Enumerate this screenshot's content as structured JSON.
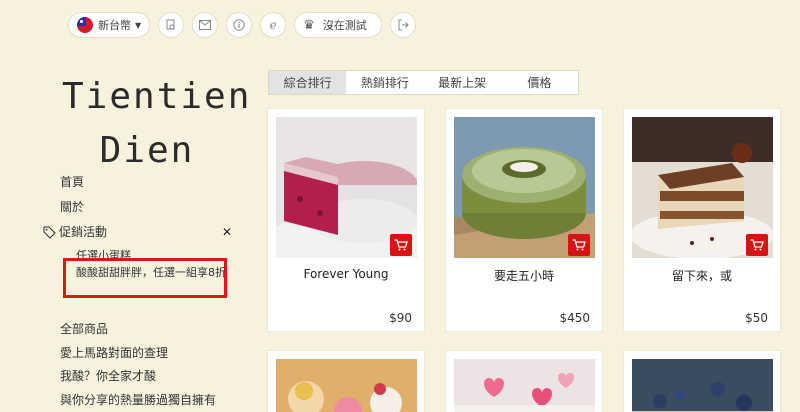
{
  "header": {
    "currency_label": "新台幣",
    "account_label": "沒在測試"
  },
  "logo": {
    "line1": "Tientien",
    "line2": "Dien"
  },
  "nav": {
    "items": [
      "首頁",
      "關於"
    ],
    "promo_label": "促銷活動",
    "promo_sub": [
      "任選小蛋糕",
      "酸酸甜甜胖胖，任選一組享8折"
    ],
    "more_items": [
      "全部商品",
      "愛上馬路對面的查理",
      "我酸？你全家才酸",
      "與你分享的熱量勝過獨自擁有"
    ]
  },
  "tabs": [
    "綜合排行",
    "熱銷排行",
    "最新上架",
    "價格"
  ],
  "products": [
    {
      "name": "Forever Young",
      "price": "$90"
    },
    {
      "name": "要走五小時",
      "price": "$450"
    },
    {
      "name": "留下來，或",
      "price": "$50"
    }
  ],
  "colors": {
    "background": "#f6f2dd",
    "accent": "#d81313",
    "highlight": "#e01616"
  }
}
